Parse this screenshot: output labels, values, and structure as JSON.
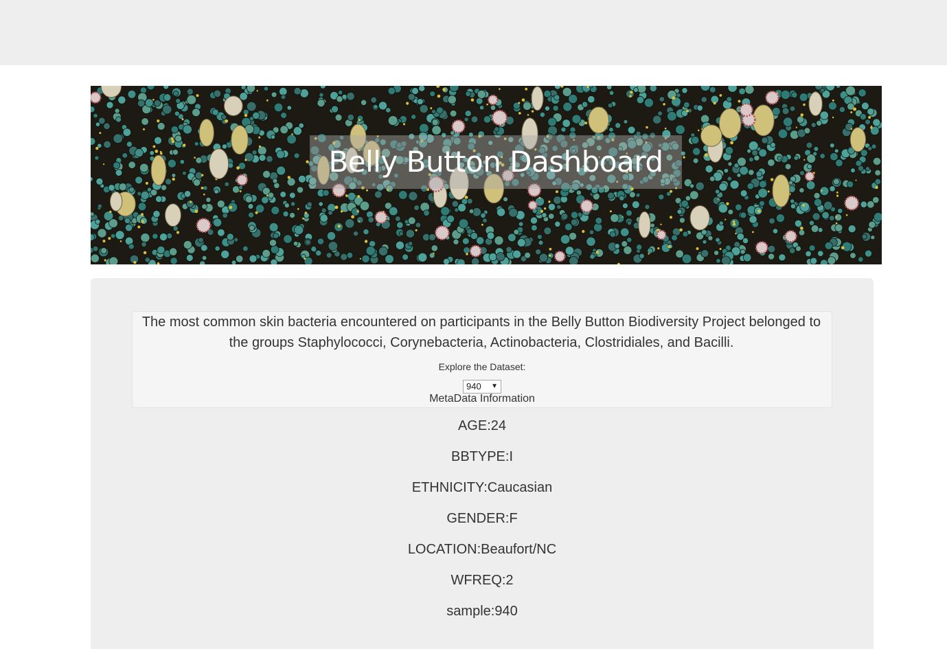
{
  "header": {
    "title": "Belly Button Dashboard"
  },
  "intro": {
    "text": "The most common skin bacteria encountered on participants in the Belly Button Biodiversity Project belonged to the groups Staphylococci, Corynebacteria, Actinobacteria, Clostridiales, and Bacilli."
  },
  "explore": {
    "label": "Explore the Dataset:",
    "selected": "940",
    "arrow": "▼"
  },
  "metadata": {
    "title": "MetaData Information",
    "items": [
      "AGE:24",
      "BBTYPE:I",
      "ETHNICITY:Caucasian",
      "GENDER:F",
      "LOCATION:Beaufort/NC",
      "WFREQ:2",
      "sample:940"
    ]
  },
  "colors": {
    "topbar": "#eeeeee",
    "panel": "#eeeeee",
    "well": "#f5f5f5",
    "text": "#333333",
    "bacteria_teal": "#3f8f88",
    "bacteria_yellow": "#d9c23a",
    "bacteria_red": "#b34a55"
  }
}
